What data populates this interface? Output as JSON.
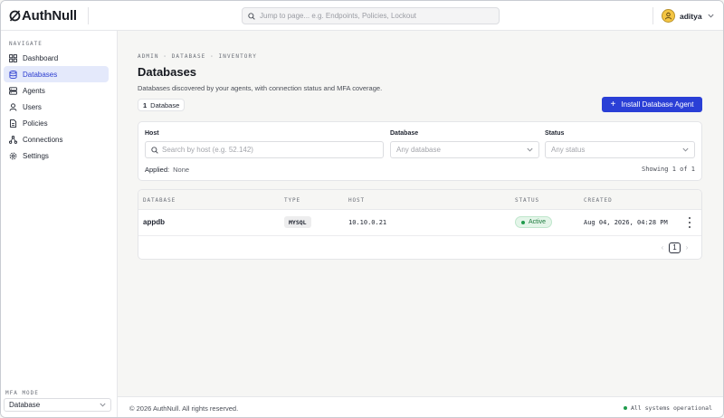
{
  "header": {
    "logo_strong": "AuthNull",
    "search_placeholder": "Jump to page... e.g. Endpoints, Policies, Lockout",
    "user_name": "aditya"
  },
  "sidebar": {
    "section_title": "NAVIGATE",
    "items": [
      {
        "label": "Dashboard",
        "icon": "dashboard-icon",
        "active": false
      },
      {
        "label": "Databases",
        "icon": "database-icon",
        "active": true
      },
      {
        "label": "Agents",
        "icon": "server-icon",
        "active": false
      },
      {
        "label": "Users",
        "icon": "user-icon",
        "active": false
      },
      {
        "label": "Policies",
        "icon": "document-icon",
        "active": false
      },
      {
        "label": "Connections",
        "icon": "connections-icon",
        "active": false
      },
      {
        "label": "Settings",
        "icon": "gear-icon",
        "active": false
      }
    ],
    "mfa_title": "MFA MODE",
    "mfa_value": "Database"
  },
  "main": {
    "breadcrumb": "ADMIN · DATABASE · INVENTORY",
    "title": "Databases",
    "description": "Databases discovered by your agents, with connection status and MFA coverage.",
    "count_number": "1",
    "count_label": "Database",
    "install_label": "Install Database Agent"
  },
  "filters": {
    "host_label": "Host",
    "host_placeholder": "Search by host (e.g. 52.142)",
    "database_label": "Database",
    "database_placeholder": "Any database",
    "status_label": "Status",
    "status_placeholder": "Any status",
    "applied_label": "Applied:",
    "applied_value": "None",
    "showing": "Showing 1 of 1"
  },
  "table": {
    "columns": [
      "DATABASE",
      "TYPE",
      "HOST",
      "STATUS",
      "CREATED"
    ],
    "rows": [
      {
        "database": "appdb",
        "type": "MYSQL",
        "host": "10.10.0.21",
        "status": "Active",
        "created": "Aug 04, 2026, 04:28 PM"
      }
    ],
    "current_page": "1"
  },
  "footer": {
    "copyright": "© 2026 AuthNull. All rights reserved.",
    "system_status": "All systems operational"
  },
  "colors": {
    "accent": "#2a3fd6",
    "active_nav_bg": "#e4e9fb",
    "success": "#1f9b4c"
  }
}
